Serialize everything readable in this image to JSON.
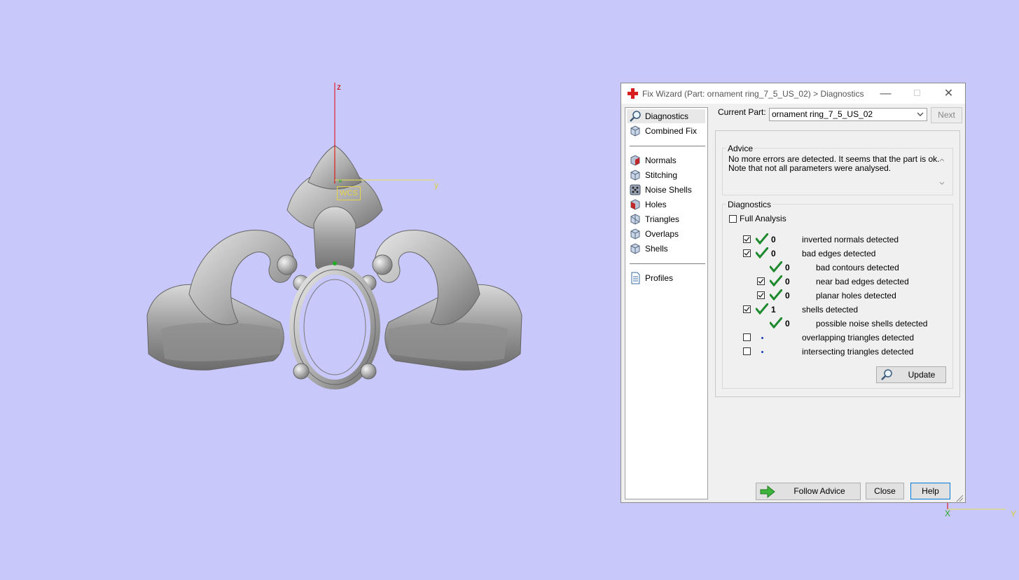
{
  "viewport": {
    "axis_z": "z",
    "axis_y": "y",
    "wcs_label": "WCS",
    "corner_axis_y": "Y",
    "corner_axis_x": "X"
  },
  "dialog": {
    "title": "Fix Wizard (Part: ornament ring_7_5_US_02) > Diagnostics",
    "nav": [
      {
        "label": "Diagnostics",
        "icon": "magnifier-icon",
        "selected": true
      },
      {
        "label": "Combined Fix",
        "icon": "combined-fix-icon"
      },
      {
        "label": "Normals",
        "icon": "normals-icon"
      },
      {
        "label": "Stitching",
        "icon": "stitching-icon"
      },
      {
        "label": "Noise Shells",
        "icon": "noise-shells-icon"
      },
      {
        "label": "Holes",
        "icon": "holes-icon"
      },
      {
        "label": "Triangles",
        "icon": "triangles-icon"
      },
      {
        "label": "Overlaps",
        "icon": "overlaps-icon"
      },
      {
        "label": "Shells",
        "icon": "shells-icon"
      },
      {
        "label": "Profiles",
        "icon": "document-icon"
      }
    ],
    "current_part_label": "Current Part:",
    "current_part_value": "ornament ring_7_5_US_02",
    "next_label": "Next",
    "advice_title": "Advice",
    "advice_line1": "No more errors are detected. It seems that the part is ok.",
    "advice_line2": "Note that not all parameters were analysed.",
    "diagnostics_title": "Diagnostics",
    "full_analysis_label": "Full Analysis",
    "full_analysis_checked": false,
    "rows": [
      {
        "checkbox": true,
        "checked": true,
        "status": "ok",
        "count": "0",
        "label": "inverted normals detected",
        "indent": 0
      },
      {
        "checkbox": true,
        "checked": true,
        "status": "ok",
        "count": "0",
        "label": "bad edges detected",
        "indent": 0
      },
      {
        "checkbox": false,
        "checked": false,
        "status": "ok",
        "count": "0",
        "label": "bad contours detected",
        "indent": 1
      },
      {
        "checkbox": true,
        "checked": true,
        "status": "ok",
        "count": "0",
        "label": "near bad edges detected",
        "indent": 1
      },
      {
        "checkbox": true,
        "checked": true,
        "status": "ok",
        "count": "0",
        "label": "planar holes detected",
        "indent": 1
      },
      {
        "checkbox": true,
        "checked": true,
        "status": "ok",
        "count": "1",
        "label": "shells detected",
        "indent": 0
      },
      {
        "checkbox": false,
        "checked": false,
        "status": "ok",
        "count": "0",
        "label": "possible noise shells detected",
        "indent": 1
      },
      {
        "checkbox": true,
        "checked": false,
        "status": "not-analysed",
        "count": "",
        "label": "overlapping triangles detected",
        "indent": 0
      },
      {
        "checkbox": true,
        "checked": false,
        "status": "not-analysed",
        "count": "",
        "label": "intersecting triangles detected",
        "indent": 0
      }
    ],
    "update_label": "Update",
    "follow_advice_label": "Follow Advice",
    "close_label": "Close",
    "help_label": "Help"
  }
}
